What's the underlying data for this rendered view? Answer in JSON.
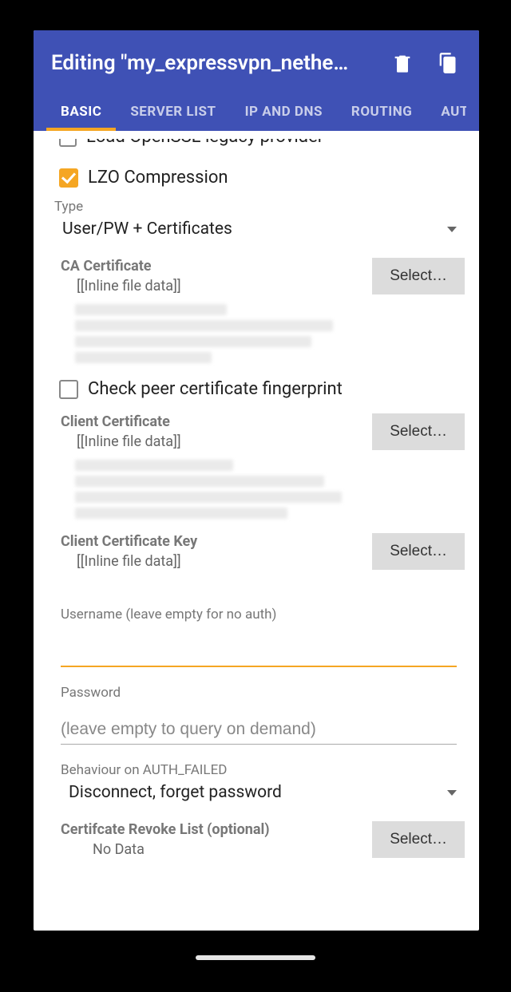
{
  "appbar": {
    "title": "Editing \"my_expressvpn_nethe…"
  },
  "tabs": [
    "BASIC",
    "SERVER LIST",
    "IP AND DNS",
    "ROUTING",
    "AUTH"
  ],
  "active_tab": 0,
  "cutoff_option": "Load OpenSSL legacy provider",
  "lzo": {
    "checked": true,
    "label": "LZO Compression"
  },
  "type": {
    "label": "Type",
    "value": "User/PW + Certificates"
  },
  "ca_cert": {
    "label": "CA Certificate",
    "value": "[[Inline file data]]",
    "button": "Select…"
  },
  "check_fingerprint": {
    "checked": false,
    "label": "Check peer certificate fingerprint"
  },
  "client_cert": {
    "label": "Client Certificate",
    "value": "[[Inline file data]]",
    "button": "Select…"
  },
  "client_key": {
    "label": "Client Certificate Key",
    "value": "[[Inline file data]]",
    "button": "Select…"
  },
  "username": {
    "label": "Username (leave empty for no auth)",
    "value": ""
  },
  "password": {
    "label": "Password",
    "placeholder": "(leave empty to query on demand)",
    "value": ""
  },
  "auth_failed": {
    "label": "Behaviour on AUTH_FAILED",
    "value": "Disconnect, forget password"
  },
  "crl": {
    "label": "Certifcate Revoke List (optional)",
    "value": "No Data",
    "button": "Select…"
  }
}
